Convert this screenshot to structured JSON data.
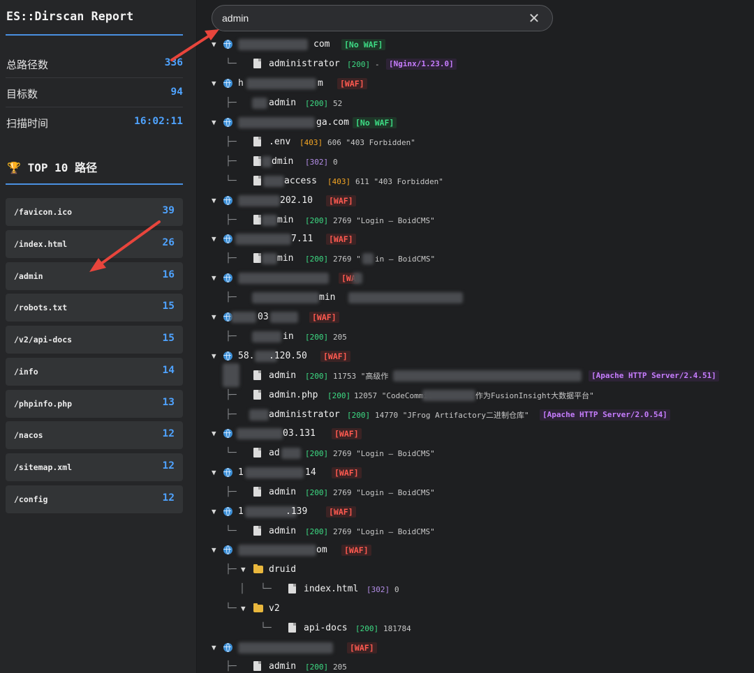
{
  "app_title": "ES::Dirscan Report",
  "stats": [
    {
      "label": "总路径数",
      "value": "336"
    },
    {
      "label": "目标数",
      "value": "94"
    },
    {
      "label": "扫描时间",
      "value": "16:02:11"
    }
  ],
  "top": {
    "icon": "trophy-icon",
    "title_prefix": "TOP 10",
    "title_zh": "路径",
    "paths": [
      {
        "path": "/favicon.ico",
        "count": "39"
      },
      {
        "path": "/index.html",
        "count": "26"
      },
      {
        "path": "/admin",
        "count": "16"
      },
      {
        "path": "/robots.txt",
        "count": "15"
      },
      {
        "path": "/v2/api-docs",
        "count": "15"
      },
      {
        "path": "/info",
        "count": "14"
      },
      {
        "path": "/phpinfo.php",
        "count": "13"
      },
      {
        "path": "/nacos",
        "count": "12"
      },
      {
        "path": "/sitemap.xml",
        "count": "12"
      },
      {
        "path": "/config",
        "count": "12"
      }
    ]
  },
  "search": {
    "value": "admin",
    "clear_icon": "close-icon"
  },
  "tree": {
    "h1": {
      "host": "com",
      "waf": "[No WAF]",
      "p1": {
        "name": "administrator",
        "status": "[200]",
        "meta": "-",
        "server": "[Nginx/1.23.0]"
      }
    },
    "h2": {
      "host_a": "h",
      "host_b": "m",
      "waf": "[WAF]",
      "p1": {
        "name": "admin",
        "status": "[200]",
        "meta": "52"
      }
    },
    "h3": {
      "host": "ga.com",
      "waf": "[No WAF]",
      "p1": {
        "name": ".env",
        "status": "[403]",
        "meta": "606 \"403 Forbidden\""
      },
      "p2": {
        "name": "dmin",
        "status": "[302]",
        "meta": "0"
      },
      "p3": {
        "name": "access",
        "status": "[403]",
        "meta": "611 \"403 Forbidden\""
      }
    },
    "h4": {
      "host": "202.10",
      "waf": "[WAF]",
      "p1": {
        "name": "min",
        "status": "[200]",
        "meta": "2769 \"Login — BoidCMS\""
      }
    },
    "h5": {
      "host": "7.11",
      "waf": "[WAF]",
      "p1": {
        "name": "min",
        "status": "[200]",
        "meta_a": "2769 \"",
        "meta_b": "in — BoidCMS\""
      }
    },
    "h6": {
      "waf": "[WA",
      "p1": {
        "name": "min"
      }
    },
    "h7": {
      "host": "03",
      "waf": "[WAF]",
      "p1": {
        "name": "in",
        "status": "[200]",
        "meta": "205"
      }
    },
    "h8": {
      "host_a": "58.",
      "host_b": ".120.50",
      "waf": "[WAF]",
      "p1": {
        "name": "admin",
        "status": "[200]",
        "meta": "11753 \"高级作",
        "server": "[Apache HTTP Server/2.4.51]"
      },
      "p2": {
        "name": "admin.php",
        "status": "[200]",
        "meta_a": "12057 \"CodeCommit",
        "meta_b": "作为FusionInsight大数据平台\""
      },
      "p3": {
        "name": "administrator",
        "status": "[200]",
        "meta": "14770 \"JFrog Artifactory二进制仓库\"",
        "server": "[Apache HTTP Server/2.0.54]"
      }
    },
    "h9": {
      "host": "03.131",
      "waf": "[WAF]",
      "p1": {
        "name": "ad",
        "status": "[200]",
        "meta": "2769 \"Login — BoidCMS\""
      }
    },
    "h10": {
      "host_a": "1",
      "host_b": "14",
      "waf": "[WAF]",
      "p1": {
        "name": "admin",
        "status": "[200]",
        "meta": "2769 \"Login — BoidCMS\""
      }
    },
    "h11": {
      "host_a": "1",
      "host_b": ".139",
      "waf": "[WAF]",
      "p1": {
        "name": "admin",
        "status": "[200]",
        "meta": "2769 \"Login — BoidCMS\""
      }
    },
    "h12": {
      "host": "om",
      "waf": "[WAF]",
      "folder1": {
        "name": "druid",
        "child": {
          "name": "index.html",
          "status": "[302]",
          "meta": "0"
        }
      },
      "folder2": {
        "name": "v2",
        "child": {
          "name": "api-docs",
          "status": "[200]",
          "meta": "181784"
        }
      }
    },
    "h13": {
      "waf": "[WAF]",
      "p1": {
        "name": "admin",
        "status": "[200]",
        "meta": "205"
      }
    }
  },
  "colors": {
    "accent_blue": "#4fa3ff",
    "status_green": "#3ddc84",
    "waf_red": "#ff5a50",
    "annotation_red": "#e8453c"
  }
}
